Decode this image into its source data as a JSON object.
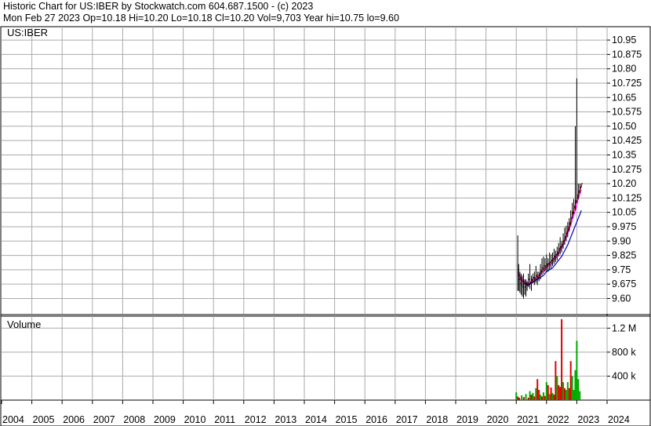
{
  "header": {
    "line1": "Historic Chart for US:IBER by Stockwatch.com 604.687.1500 - (c) 2023",
    "line2": "Mon Feb 27 2023   Op=10.18   Hi=10.20   Lo=10.18   Cl=10.20   Vol=9,703   Year hi=10.75   lo=9.60"
  },
  "colors": {
    "price": "#000000",
    "ma_short": "#ff0000",
    "ma_mid": "#ff00ff",
    "ma_long": "#0000cc",
    "vol_up": "#00aa00",
    "vol_down": "#dd0000",
    "grid": "#aaaaaa"
  },
  "chart_data": [
    {
      "type": "line",
      "title": "US:IBER",
      "ylim": [
        9.52,
        11.02
      ],
      "y_ticks": [
        "10.95",
        "10.875",
        "10.80",
        "10.725",
        "10.65",
        "10.575",
        "10.50",
        "10.425",
        "10.35",
        "10.275",
        "10.20",
        "10.125",
        "10.05",
        "9.975",
        "9.90",
        "9.825",
        "9.75",
        "9.675",
        "9.60"
      ],
      "x_labels": [
        "2004",
        "2005",
        "2006",
        "2007",
        "2008",
        "2009",
        "2010",
        "2011",
        "2012",
        "2013",
        "2014",
        "2015",
        "2016",
        "2017",
        "2018",
        "2019",
        "2020",
        "2021",
        "2022",
        "2023",
        "2024"
      ],
      "x_range": [
        2004.0,
        2024.0
      ],
      "series": [
        {
          "style": "hlc-bars",
          "x": [
            2021.05,
            2021.08,
            2021.12,
            2021.16,
            2021.2,
            2021.24,
            2021.28,
            2021.32,
            2021.36,
            2021.4,
            2021.45,
            2021.5,
            2021.55,
            2021.6,
            2021.65,
            2021.7,
            2021.75,
            2021.8,
            2021.85,
            2021.9,
            2021.95,
            2022.0,
            2022.05,
            2022.1,
            2022.15,
            2022.2,
            2022.25,
            2022.3,
            2022.35,
            2022.4,
            2022.45,
            2022.5,
            2022.55,
            2022.6,
            2022.65,
            2022.7,
            2022.75,
            2022.8,
            2022.85,
            2022.9,
            2022.95,
            2023.0,
            2023.05,
            2023.1,
            2023.15
          ],
          "high": [
            9.93,
            9.78,
            9.74,
            9.73,
            9.72,
            9.73,
            9.7,
            9.7,
            9.69,
            9.73,
            9.78,
            9.72,
            9.73,
            9.74,
            9.77,
            9.74,
            9.74,
            9.78,
            9.81,
            9.82,
            9.81,
            9.83,
            9.81,
            9.84,
            9.83,
            9.84,
            9.86,
            9.85,
            9.87,
            9.89,
            9.92,
            9.9,
            9.94,
            9.97,
            9.98,
            10.0,
            10.02,
            10.06,
            10.1,
            10.12,
            10.5,
            10.75,
            10.2,
            10.2,
            10.2
          ],
          "low": [
            9.64,
            9.64,
            9.63,
            9.62,
            9.61,
            9.6,
            9.62,
            9.61,
            9.64,
            9.66,
            9.65,
            9.64,
            9.68,
            9.67,
            9.68,
            9.67,
            9.69,
            9.7,
            9.72,
            9.73,
            9.74,
            9.74,
            9.74,
            9.75,
            9.76,
            9.77,
            9.78,
            9.79,
            9.8,
            9.82,
            9.83,
            9.84,
            9.86,
            9.88,
            9.9,
            9.92,
            9.95,
            9.98,
            10.02,
            10.04,
            10.06,
            10.1,
            10.12,
            10.15,
            10.18
          ],
          "close": [
            9.75,
            9.7,
            9.68,
            9.67,
            9.66,
            9.68,
            9.66,
            9.67,
            9.67,
            9.7,
            9.68,
            9.7,
            9.71,
            9.7,
            9.72,
            9.71,
            9.72,
            9.74,
            9.76,
            9.77,
            9.77,
            9.78,
            9.78,
            9.79,
            9.8,
            9.81,
            9.82,
            9.83,
            9.84,
            9.86,
            9.87,
            9.88,
            9.9,
            9.92,
            9.94,
            9.96,
            9.99,
            10.02,
            10.05,
            10.08,
            10.11,
            10.14,
            10.16,
            10.18,
            10.2
          ]
        },
        {
          "name": "",
          "color_key": "ma_short",
          "x": [
            2021.05,
            2021.15,
            2021.25,
            2021.35,
            2021.45,
            2021.55,
            2021.65,
            2021.75,
            2021.85,
            2021.95,
            2022.05,
            2022.15,
            2022.25,
            2022.35,
            2022.45,
            2022.55,
            2022.65,
            2022.75,
            2022.85,
            2022.95,
            2023.05,
            2023.15
          ],
          "values": [
            9.74,
            9.7,
            9.68,
            9.67,
            9.68,
            9.7,
            9.71,
            9.72,
            9.75,
            9.76,
            9.78,
            9.79,
            9.81,
            9.83,
            9.86,
            9.89,
            9.93,
            9.98,
            10.03,
            10.09,
            10.14,
            10.19
          ]
        },
        {
          "name": "",
          "color_key": "ma_mid",
          "x": [
            2021.05,
            2021.15,
            2021.25,
            2021.35,
            2021.45,
            2021.55,
            2021.65,
            2021.75,
            2021.85,
            2021.95,
            2022.05,
            2022.15,
            2022.25,
            2022.35,
            2022.45,
            2022.55,
            2022.65,
            2022.75,
            2022.85,
            2022.95,
            2023.05,
            2023.15
          ],
          "values": [
            9.73,
            9.71,
            9.69,
            9.68,
            9.68,
            9.69,
            9.7,
            9.71,
            9.74,
            9.75,
            9.77,
            9.78,
            9.8,
            9.82,
            9.85,
            9.88,
            9.92,
            9.96,
            10.01,
            10.06,
            10.12,
            10.17
          ]
        },
        {
          "name": "",
          "color_key": "ma_long",
          "x": [
            2021.3,
            2021.4,
            2021.5,
            2021.6,
            2021.7,
            2021.8,
            2021.9,
            2022.0,
            2022.1,
            2022.2,
            2022.3,
            2022.4,
            2022.5,
            2022.6,
            2022.7,
            2022.8,
            2022.9,
            2023.0,
            2023.1,
            2023.15
          ],
          "values": [
            9.68,
            9.67,
            9.68,
            9.69,
            9.7,
            9.71,
            9.72,
            9.74,
            9.75,
            9.76,
            9.78,
            9.8,
            9.82,
            9.85,
            9.88,
            9.92,
            9.96,
            10.0,
            10.04,
            10.06
          ]
        }
      ]
    },
    {
      "type": "bar",
      "title": "Volume",
      "ylim": [
        0,
        1400000
      ],
      "y_ticks": [
        {
          "label": "1.2 M",
          "value": 1200000
        },
        {
          "label": "800 k",
          "value": 800000
        },
        {
          "label": "400 k",
          "value": 400000
        }
      ],
      "x": [
        2021.0,
        2021.05,
        2021.1,
        2021.18,
        2021.25,
        2021.32,
        2021.4,
        2021.45,
        2021.5,
        2021.55,
        2021.6,
        2021.65,
        2021.7,
        2021.75,
        2021.8,
        2021.85,
        2021.9,
        2021.95,
        2022.0,
        2022.05,
        2022.1,
        2022.15,
        2022.2,
        2022.25,
        2022.3,
        2022.35,
        2022.4,
        2022.45,
        2022.5,
        2022.55,
        2022.6,
        2022.65,
        2022.7,
        2022.75,
        2022.8,
        2022.85,
        2022.9,
        2022.95,
        2023.0,
        2023.05,
        2023.1
      ],
      "values": [
        130000,
        60000,
        40000,
        80000,
        50000,
        100000,
        40000,
        150000,
        90000,
        120000,
        60000,
        200000,
        350000,
        170000,
        90000,
        60000,
        130000,
        70000,
        300000,
        250000,
        100000,
        210000,
        120000,
        90000,
        650000,
        400000,
        250000,
        220000,
        1350000,
        300000,
        200000,
        170000,
        300000,
        200000,
        650000,
        400000,
        170000,
        500000,
        990000,
        350000,
        150000
      ],
      "up": [
        true,
        false,
        false,
        true,
        false,
        true,
        false,
        true,
        false,
        true,
        false,
        true,
        false,
        false,
        true,
        false,
        true,
        false,
        true,
        false,
        true,
        false,
        true,
        false,
        false,
        true,
        false,
        false,
        false,
        true,
        false,
        true,
        true,
        false,
        false,
        true,
        true,
        true,
        true,
        true,
        true
      ]
    }
  ]
}
